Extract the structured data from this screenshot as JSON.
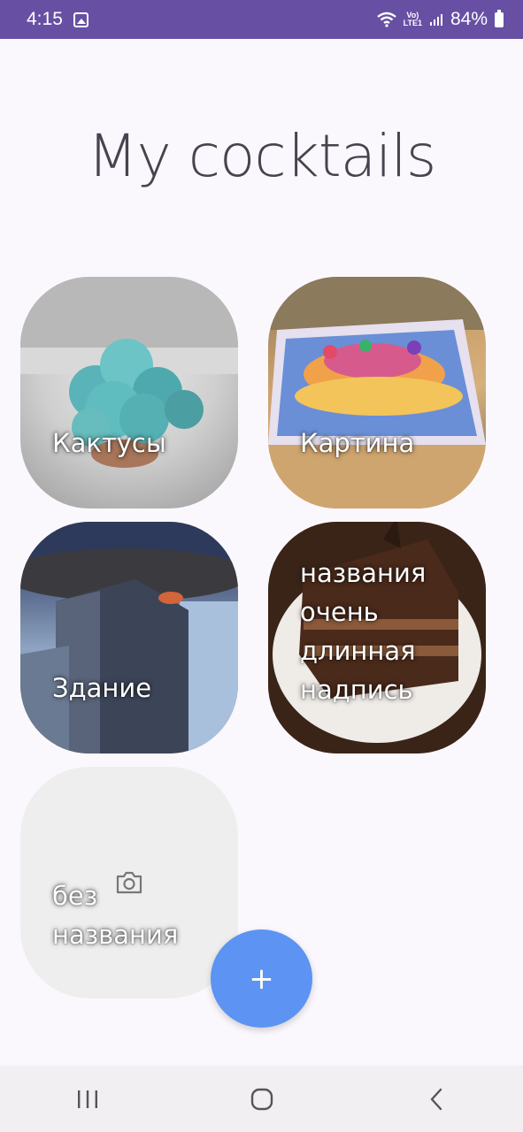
{
  "status_bar": {
    "time": "4:15",
    "network_top": "Vo)",
    "network_bottom": "LTE1",
    "battery_percent": "84%",
    "icons": [
      "image-icon",
      "wifi-icon",
      "signal-icon",
      "battery-icon"
    ]
  },
  "page": {
    "title": "My cocktails"
  },
  "cards": [
    {
      "label": "Кактусы",
      "image": "cactus-photo"
    },
    {
      "label": "Картина",
      "image": "painting-photo"
    },
    {
      "label": "Здание",
      "image": "building-photo"
    },
    {
      "label_lines": [
        "названия",
        "очень",
        "длинная",
        "надпись"
      ],
      "image": "cake-photo"
    },
    {
      "label_lines": [
        "без",
        "названия"
      ],
      "image": "camera-icon"
    }
  ],
  "fab": {
    "label": "+",
    "color": "#5d93f2"
  },
  "navigation": {
    "buttons": [
      "recent-apps-icon",
      "home-icon",
      "back-icon"
    ]
  },
  "colors": {
    "status_bar": "#6750a4",
    "background": "#fbf8fd",
    "title": "#45444f"
  }
}
